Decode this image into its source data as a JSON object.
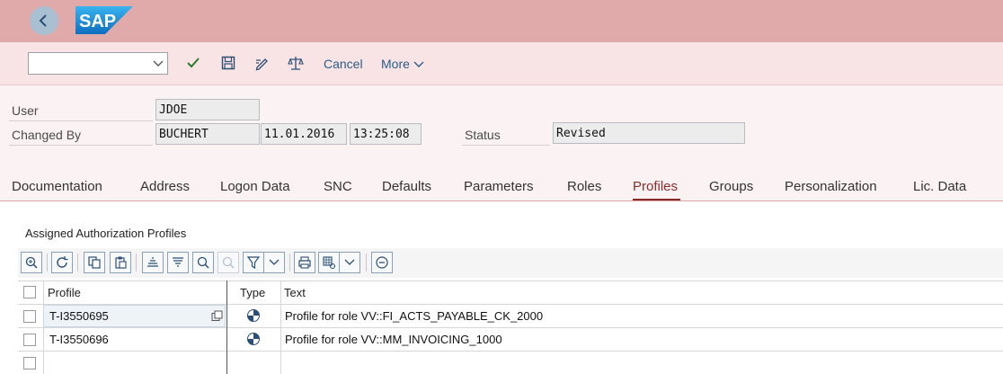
{
  "shell": {
    "logo_text": "SAP",
    "back_icon": "chevron-left-icon"
  },
  "toolbar": {
    "command_field_value": "",
    "cancel_label": "Cancel",
    "more_label": "More",
    "icons": [
      "check-icon",
      "save-icon",
      "edit-icon",
      "balance-icon"
    ]
  },
  "header": {
    "user_label": "User",
    "user_value": "JDOE",
    "changed_by_label": "Changed By",
    "changed_by_value": "BUCHERT",
    "changed_date": "11.01.2016",
    "changed_time": "13:25:08",
    "status_label": "Status",
    "status_value": "Revised"
  },
  "tabs": [
    {
      "label": "Documentation"
    },
    {
      "label": "Address"
    },
    {
      "label": "Logon Data"
    },
    {
      "label": "SNC"
    },
    {
      "label": "Defaults"
    },
    {
      "label": "Parameters"
    },
    {
      "label": "Roles"
    },
    {
      "label": "Profiles",
      "active": true
    },
    {
      "label": "Groups"
    },
    {
      "label": "Personalization"
    },
    {
      "label": "Lic. Data"
    }
  ],
  "section": {
    "title": "Assigned Authorization Profiles"
  },
  "grid": {
    "columns": {
      "profile": "Profile",
      "type": "Type",
      "text": "Text"
    },
    "rows": [
      {
        "profile": "T-I3550695",
        "type_icon": "single-profile-icon",
        "text": "Profile for role VV::FI_ACTS_PAYABLE_CK_2000"
      },
      {
        "profile": "T-I3550696",
        "type_icon": "single-profile-icon",
        "text": "Profile for role VV::MM_INVOICING_1000"
      }
    ]
  },
  "colors": {
    "shell_bg": "#e0aaaa",
    "toolbar_bg": "#f8e4e4",
    "accent": "#8b2c2c",
    "link": "#2b5c8a"
  }
}
